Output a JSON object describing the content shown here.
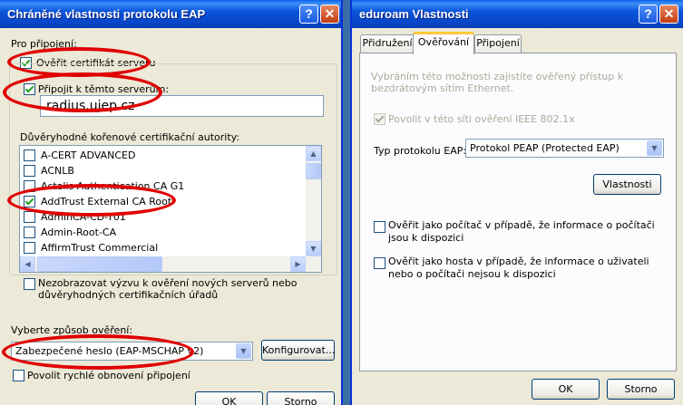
{
  "left_window": {
    "title": "Chráněné vlastnosti protokolu EAP",
    "connect_label": "Pro připojení:",
    "verify_cert_label": "Ověřit certifikát serveru",
    "verify_cert_checked": true,
    "connect_servers_label": "Připojit k těmto serverům:",
    "connect_servers_checked": true,
    "server_value": "radius.ujep.cz",
    "ca_label": "Důvěryhodné kořenové certifikační autority:",
    "ca_items": [
      {
        "label": "A-CERT ADVANCED",
        "checked": false
      },
      {
        "label": "ACNLB",
        "checked": false
      },
      {
        "label": "Actalis Authentication CA G1",
        "checked": false
      },
      {
        "label": "AddTrust External CA Root",
        "checked": true
      },
      {
        "label": "AdminCA-CD-T01",
        "checked": false
      },
      {
        "label": "Admin-Root-CA",
        "checked": false
      },
      {
        "label": "AffirmTrust Commercial",
        "checked": false
      }
    ],
    "no_prompt_label": "Nezobrazovat výzvu k ověření nových serverů nebo důvěryhodných certifikačních úřadů",
    "no_prompt_checked": false,
    "auth_method_label": "Vyberte způsob ověření:",
    "auth_method_value": "Zabezpečené heslo (EAP-MSCHAP v2)",
    "configure_label": "Konfigurovat...",
    "fast_reconnect_label": "Povolit rychlé obnovení připojení",
    "fast_reconnect_checked": false,
    "ok_label": "OK",
    "cancel_label": "Storno"
  },
  "right_window": {
    "title": "eduroam Vlastnosti",
    "tabs": [
      {
        "label": "Přidružení",
        "active": false
      },
      {
        "label": "Ověřování",
        "active": true
      },
      {
        "label": "Připojení",
        "active": false
      }
    ],
    "description": "Vybráním této možnosti zajistíte ověřený přístup k bezdrátovým sítím Ethernet.",
    "enable_8021x_label": "Povolit v této síti ověření IEEE 802.1x",
    "enable_8021x_checked": true,
    "eap_type_label": "Typ protokolu EAP:",
    "eap_type_value": "Protokol PEAP (Protected EAP)",
    "properties_label": "Vlastnosti",
    "computer_auth_label": "Ověřit jako počítač v případě, že informace o počítači jsou k dispozici",
    "computer_auth_checked": false,
    "guest_auth_label": "Ověřit jako hosta v případě, že informace o uživateli nebo o počítači nejsou k dispozici",
    "guest_auth_checked": false,
    "ok_label": "OK",
    "cancel_label": "Storno"
  },
  "title_buttons": {
    "help": "?",
    "close": "✕"
  },
  "colors": {
    "annotation_circle": "#e00000",
    "titlebar": "#0a55dc",
    "dialog_bg": "#ece9d8"
  }
}
